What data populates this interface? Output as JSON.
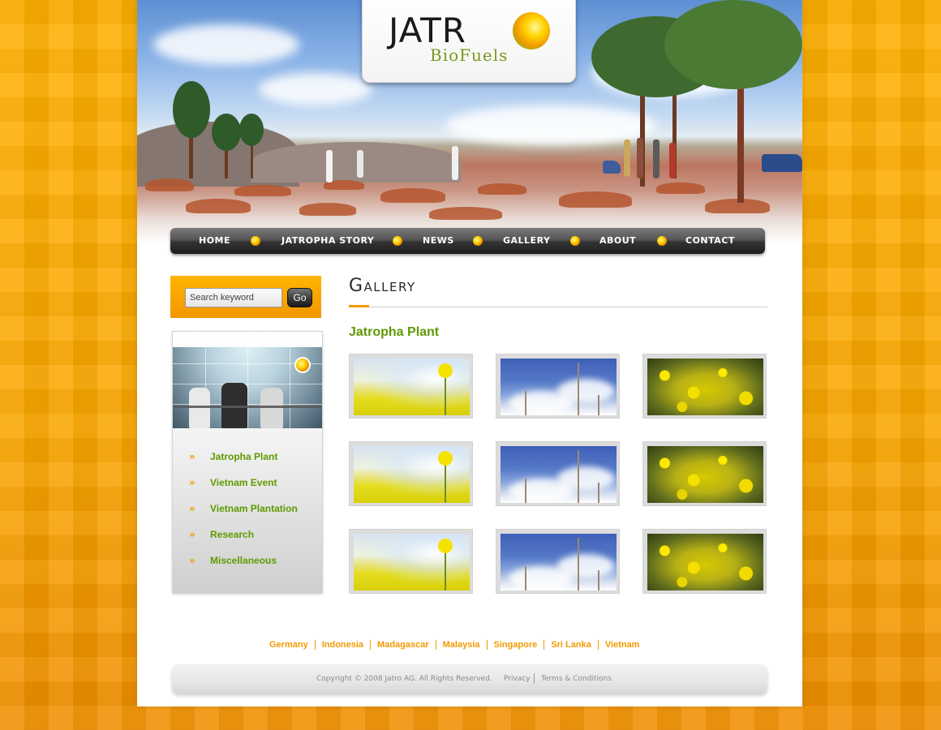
{
  "brand": {
    "logo_main": "JATR",
    "logo_sub": "BioFuels"
  },
  "nav": {
    "items": [
      {
        "label": "HOME"
      },
      {
        "label": "JATROPHA STORY"
      },
      {
        "label": "NEWS"
      },
      {
        "label": "GALLERY"
      },
      {
        "label": "ABOUT"
      },
      {
        "label": "CONTACT"
      }
    ]
  },
  "search": {
    "placeholder": "Search keyword",
    "button_label": "Go"
  },
  "sidebar": {
    "categories": [
      {
        "label": "Jatropha Plant"
      },
      {
        "label": "Vietnam Event"
      },
      {
        "label": "Vietnam Plantation"
      },
      {
        "label": "Research"
      },
      {
        "label": "Miscellaneous"
      }
    ]
  },
  "main": {
    "page_title": "Gallery",
    "section_heading": "Jatropha Plant",
    "thumbnails": [
      {
        "image": "yellow-flower"
      },
      {
        "image": "sky-grass"
      },
      {
        "image": "flower-field"
      },
      {
        "image": "yellow-flower"
      },
      {
        "image": "sky-grass"
      },
      {
        "image": "flower-field"
      },
      {
        "image": "yellow-flower"
      },
      {
        "image": "sky-grass"
      },
      {
        "image": "flower-field"
      }
    ]
  },
  "footer": {
    "countries": [
      "Germany",
      "Indonesia",
      "Madagascar",
      "Malaysia",
      "Singapore",
      "Sri Lanka",
      "Vietnam"
    ],
    "copyright": "Copyright © 2008 Jatro AG. All Rights Reserved.",
    "privacy_label": "Privacy",
    "terms_label": "Terms & Conditions"
  },
  "colors": {
    "accent_orange": "#f39a00",
    "heading_green": "#5f9a00",
    "nav_dark": "#333333"
  }
}
